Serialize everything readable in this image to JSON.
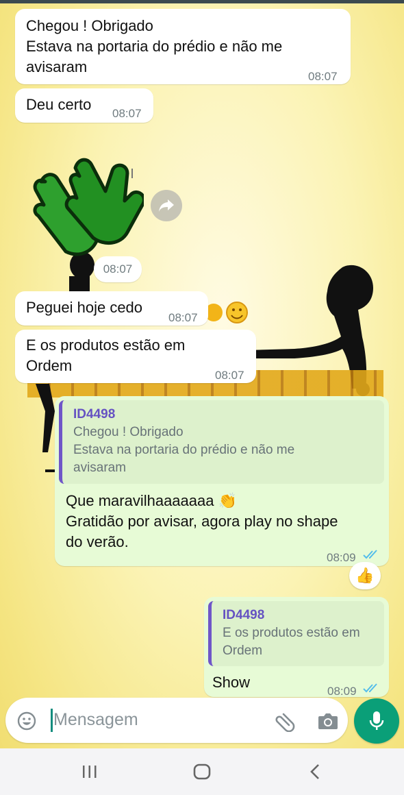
{
  "chat": {
    "messages": [
      {
        "text": "Chegou ! Obrigado\nEstava na portaria do prédio e não me avisaram",
        "time": "08:07"
      },
      {
        "text": "Deu certo",
        "time": "08:07"
      },
      {
        "sticker": "clapping-hands-sticker",
        "time": "08:07"
      },
      {
        "text": "Peguei hoje cedo",
        "time": "08:07"
      },
      {
        "text": "E os produtos estão em\nOrdem",
        "time": "08:07"
      },
      {
        "quote_author": "ID4498",
        "quote_text": "Chegou ! Obrigado\nEstava na portaria do prédio e não me\navisaram",
        "text": "Que maravilhaaaaaaa 👏\nGratidão por avisar, agora play no shape\ndo verão.",
        "time": "08:09",
        "reaction": "👍"
      },
      {
        "quote_author": "ID4498",
        "quote_text": "E os produtos estão em\nOrdem",
        "text": "Show",
        "time": "08:09"
      }
    ]
  },
  "composer": {
    "placeholder": "Mensagem"
  },
  "icons": {
    "emoji": "emoji-icon",
    "attach": "paperclip-icon",
    "camera": "camera-icon",
    "mic": "microphone-icon",
    "forward": "forward-icon",
    "ticks": "double-check-icon"
  },
  "colors": {
    "accent": "#0a9f78",
    "quote_bar": "#6f56c8",
    "outgoing": "#e7fbd6",
    "ticks": "#53bdeb"
  }
}
